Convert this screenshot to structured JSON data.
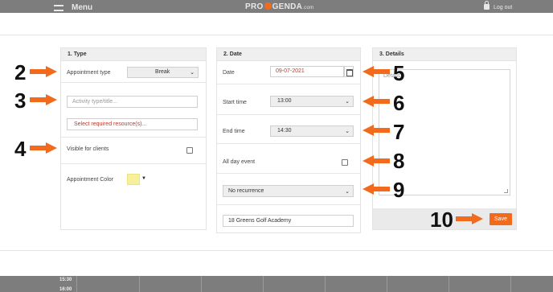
{
  "topbar": {
    "menu_label": "Menu",
    "logo_pre": "PRO",
    "logo_post": "GENDA",
    "logo_suffix": ".com",
    "logout_label": "Log out"
  },
  "type_panel": {
    "title": "1. Type",
    "appointment_type_label": "Appointment type",
    "appointment_type_value": "Break",
    "activity_placeholder": "Activity type/title...",
    "resources_label": "Select required resource(s)...",
    "visible_label": "Visible for clients",
    "color_label": "Appointment Color",
    "color_value": "#f7f09a"
  },
  "date_panel": {
    "title": "2. Date",
    "date_label": "Date",
    "date_value": "09-07-2021",
    "start_label": "Start time",
    "start_value": "13:00",
    "end_label": "End time",
    "end_value": "14:30",
    "allday_label": "All day event",
    "recurrence_value": "No recurrence",
    "location_value": "18 Greens Golf Academy"
  },
  "details_panel": {
    "title": "3. Details",
    "details_placeholder": "Details",
    "save_label": "Save"
  },
  "callouts": [
    "2",
    "3",
    "4",
    "5",
    "6",
    "7",
    "8",
    "9",
    "10"
  ],
  "calendar_bg": {
    "times": [
      "15:30",
      "16:00"
    ]
  },
  "colors": {
    "accent": "#f26b1d",
    "arrow": "#f26b1d"
  }
}
